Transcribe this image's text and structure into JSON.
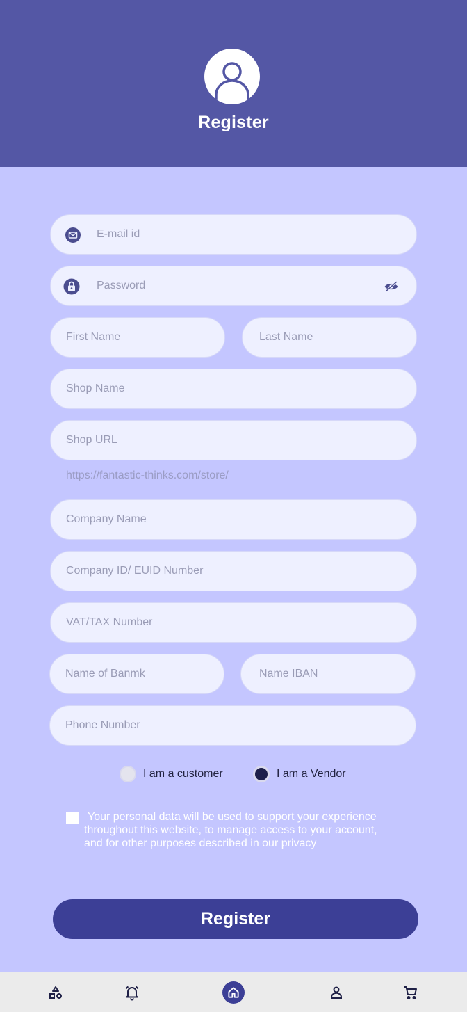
{
  "header": {
    "title": "Register"
  },
  "form": {
    "email": {
      "placeholder": "E-mail id",
      "value": ""
    },
    "password": {
      "placeholder": "Password",
      "value": ""
    },
    "first_name": {
      "placeholder": "First Name",
      "value": ""
    },
    "last_name": {
      "placeholder": "Last Name",
      "value": ""
    },
    "shop_name": {
      "placeholder": "Shop Name",
      "value": ""
    },
    "shop_url": {
      "placeholder": "Shop URL",
      "value": ""
    },
    "shop_url_hint": "https://fantastic-thinks.com/store/",
    "company_name": {
      "placeholder": "Company Name",
      "value": ""
    },
    "company_id": {
      "placeholder": "Company ID/ EUID Number",
      "value": ""
    },
    "vat": {
      "placeholder": "VAT/TAX Number",
      "value": ""
    },
    "bank_name": {
      "placeholder": "Name of Banmk",
      "value": ""
    },
    "iban": {
      "placeholder": "Name IBAN",
      "value": ""
    },
    "phone": {
      "placeholder": "Phone Number",
      "value": ""
    },
    "role_options": [
      {
        "label": "I am a customer",
        "selected": false
      },
      {
        "label": "I am a Vendor",
        "selected": true
      }
    ],
    "consent_text": "Your personal data will be used to support your experience throughout this website, to manage access to your account, and for other purposes described in our privacy",
    "submit_label": "Register"
  },
  "icons": {
    "avatar": "user-icon",
    "email": "mail-icon",
    "password": "lock-icon",
    "password_toggle": "eye-off-icon",
    "nav": [
      "shapes-icon",
      "bell-icon",
      "home-icon",
      "user-icon",
      "cart-icon"
    ]
  },
  "colors": {
    "header_bg": "#5457a5",
    "page_bg": "#c4c6ff",
    "field_bg": "#eef0ff",
    "accent": "#3c3f96",
    "nav_bg": "#ebebeb"
  }
}
